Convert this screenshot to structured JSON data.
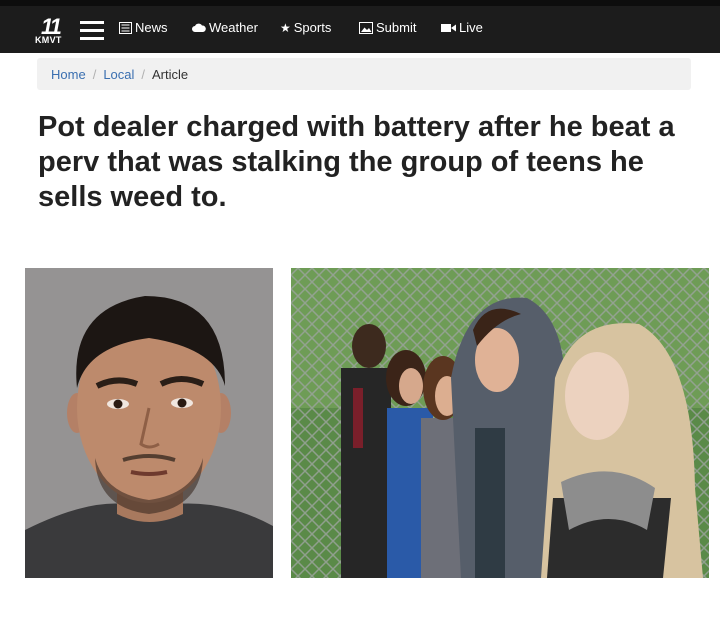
{
  "brand": {
    "number": "11",
    "callsign": "KMVT"
  },
  "nav": {
    "news": "News",
    "weather": "Weather",
    "sports": "Sports",
    "submit": "Submit",
    "live": "Live"
  },
  "breadcrumb": {
    "home": "Home",
    "section": "Local",
    "current": "Article"
  },
  "article": {
    "headline": "Pot dealer charged with battery after he beat a perv that was stalking the group of teens he sells weed to."
  },
  "colors": {
    "topbar": "#1c1c1c",
    "link": "#3a6fb0",
    "headline": "#222222"
  }
}
